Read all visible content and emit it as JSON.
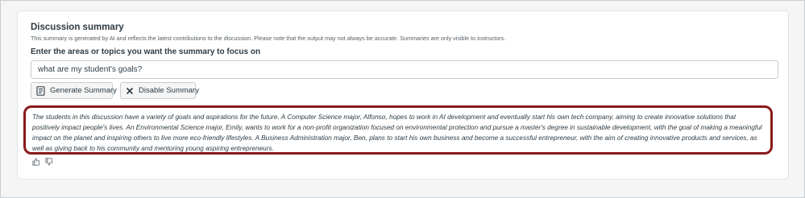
{
  "summary_panel": {
    "title": "Discussion summary",
    "notice": "This summary is generated by AI and reflects the latest contributions to the discussion. Please note that the output may not always be accurate. Summaries are only visible to instructors.",
    "focus_label": "Enter the areas or topics you want the summary to focus on",
    "focus_input_value": "what are my student's goals?",
    "buttons": {
      "generate_label": "Generate Summary",
      "disable_label": "Disable Summary"
    },
    "summary_text": "The students in this discussion have a variety of goals and aspirations for the future. A Computer Science major, Alfonso, hopes to work in AI development and eventually start his own tech company, aiming to create innovative solutions that positively impact people's lives. An Environmental Science major, Emily, wants to work for a non-profit organization focused on environmental protection and pursue a master's degree in sustainable development, with the goal of making a meaningful impact on the planet and inspiring others to live more eco-friendly lifestyles. A Business Administration major, Ben, plans to start his own business and become a successful entrepreneur, with the aim of creating innovative products and services, as well as giving back to his community and mentoring young aspiring entrepreneurs.",
    "icons": [
      "document-icon",
      "close-icon",
      "thumbs-up-icon",
      "thumbs-down-icon"
    ],
    "colors": {
      "highlight_border": "#8b1a1a",
      "text": "#2d3b45",
      "button_bg": "#f5f5f5"
    }
  }
}
